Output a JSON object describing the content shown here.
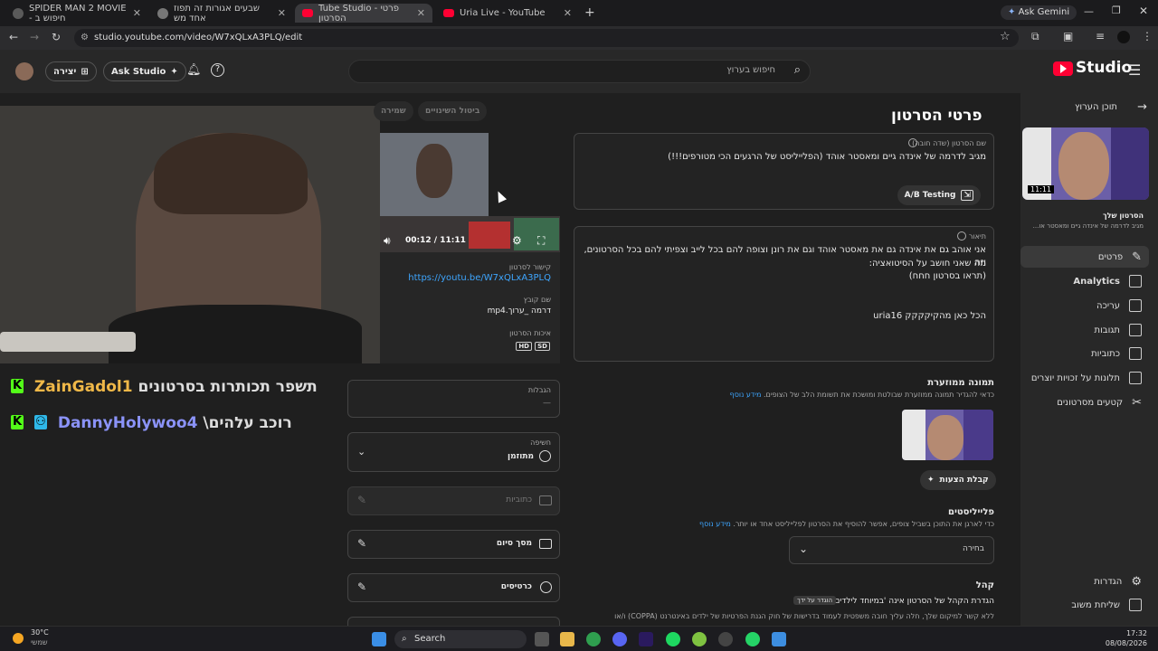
{
  "browser": {
    "tabs": [
      {
        "title": "SPIDER MAN 2 MOVIE - חיפוש ב",
        "fav_color": "#5a5a5a"
      },
      {
        "title": "שבעים אגורות זה תפוז אחד מש",
        "fav_color": "#777777"
      },
      {
        "title": "Tube Studio - פרטי הסרטון",
        "fav_color": "#ff0033"
      },
      {
        "title": "Uria Live - YouTube",
        "fav_color": "#ff0033"
      }
    ],
    "active_tab": 2,
    "new_tab": "+",
    "gemini_label": "Ask Gemini",
    "url": "studio.youtube.com/video/W7xQLxA3PLQ/edit"
  },
  "header": {
    "create_label": "יצירה",
    "ask_studio_label": "Ask Studio",
    "search_placeholder": "חיפוש בערוץ",
    "logo_text": "Studio"
  },
  "chat": [
    {
      "user": "ZainGadol1",
      "user_color": "#f0b848",
      "message": "תשפר תכותרות בסרטונים"
    },
    {
      "user": "DannyHolywoo4",
      "user_color": "#8b93f8",
      "message": "\\רוכב עלהים"
    }
  ],
  "sidebar": {
    "back_label": "תוכן הערוץ",
    "thumb_duration": "11:11",
    "video_label": "הסרטון שלך",
    "video_title_short": "מגיב לדרמה של אינדה גיים ומאסטר או...",
    "items": [
      {
        "label": "פרטים",
        "icon": "pencil-icon",
        "selected": true
      },
      {
        "label": "Analytics",
        "icon": "analytics-icon",
        "selected": false
      },
      {
        "label": "עריכה",
        "icon": "film-icon",
        "selected": false
      },
      {
        "label": "תגובות",
        "icon": "comment-icon",
        "selected": false
      },
      {
        "label": "כתוביות",
        "icon": "subtitles-icon",
        "selected": false
      },
      {
        "label": "תלונות על זכויות יוצרים",
        "icon": "copyright-icon",
        "selected": false
      },
      {
        "label": "קטעים מסרטונים",
        "icon": "scissors-icon",
        "selected": false
      }
    ],
    "settings_label": "הגדרות",
    "feedback_label": "שליחת משוב"
  },
  "details": {
    "page_title": "פרטי הסרטון",
    "undo_label": "ביטול השינויים",
    "save_label": "שמירה",
    "title_label": "שם הסרטון (שדה חובה)",
    "title_value": "מגיב לדרמה של אינדה גיים ומאסטר אוהד (הפלייליסט של הרגעים הכי מטורפים!!!)",
    "ab_label": "A/B Testing",
    "desc_label": "תיאור",
    "desc_line1": "אני אוהב גם את אינדה גם את מאסטר אוהד וגם את רונן וצופה להם בכל לייב וצפיתי להם בכל הסרטונים, וזה",
    "desc_line2": "מה שאני חושב על הסיטואציה:",
    "desc_line3": "(תראו בסרטון חחח)",
    "desc_line4": "הכל כאן מהקיקקקק uria16",
    "thumb_heading": "תמונה ממוזערת",
    "thumb_help": "כדאי להגדיר תמונה ממוזערת שבולטת ומושכת את תשומת הלב של הצופים.",
    "learn_more": "מידע נוסף",
    "suggest_label": "קבלת הצעות",
    "playlist_heading": "פלייליסטים",
    "playlist_help": "כדי לארגן את התוכן בשביל צופים, אפשר להוסיף את הסרטון לפלייליסט אחד או יותר.",
    "playlist_select": "בחירה",
    "audience_heading": "קהל",
    "audience_text": "הגדרת הקהל של הסרטון אינה 'במיוחד לילדים'",
    "audience_badge": "הוגדר על ידך",
    "audience_text2": "ללא קשר למיקום שלך, חלה עליך חובה משפטית לעמוד בדרישות של חוק הגנת הפרטיות של ילדים באינטרנט (COPPA) ו/או"
  },
  "video_panel": {
    "time": "00:12 / 11:11",
    "link_label": "קישור לסרטון",
    "link": "https://youtu.be/W7xQLxA3PLQ",
    "file_label": "שם קובץ",
    "file_name": "דרמה _ערוך.mp4",
    "quality_label": "איכות הסרטון",
    "quality_hd": "HD",
    "quality_sd": "SD",
    "restrictions_label": "הגבלות",
    "restrictions_value": "—",
    "visibility_label": "חשיפה",
    "visibility_value": "מתוזמן",
    "subtitles_label": "כתוביות",
    "endscreen_label": "מסך סיום",
    "cards_label": "כרטיסים"
  },
  "taskbar": {
    "temp": "30°C",
    "weather": "שמשי",
    "search": "Search",
    "time": "17:32",
    "date": "08/08/2026"
  }
}
